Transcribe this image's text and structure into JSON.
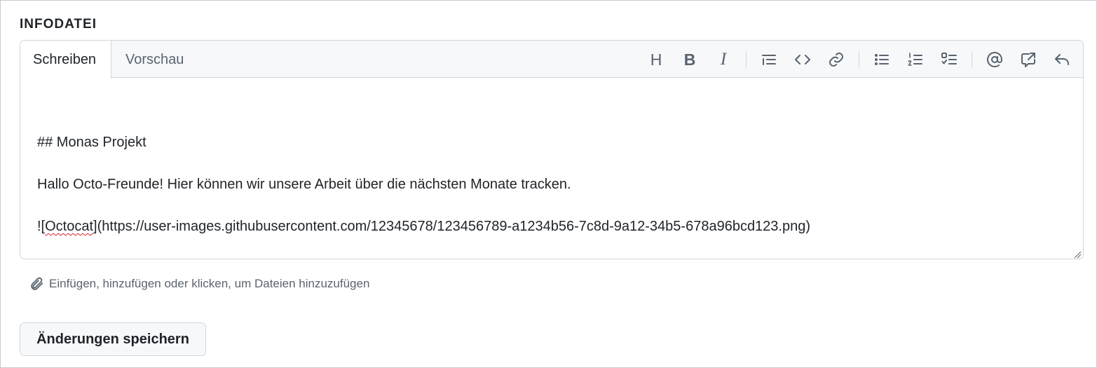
{
  "section_title": "INFODATEI",
  "tabs": {
    "write": "Schreiben",
    "preview": "Vorschau"
  },
  "toolbar": {
    "heading": "H",
    "bold": "B",
    "italic": "I",
    "icons": [
      "quote-icon",
      "code-icon",
      "link-icon",
      "unordered-list-icon",
      "ordered-list-icon",
      "task-list-icon",
      "mention-icon",
      "cross-reference-icon",
      "saved-reply-icon"
    ]
  },
  "content": {
    "line1": "## Monas Projekt",
    "line2": "Hallo Octo-Freunde! Hier können wir unsere Arbeit über die nächsten Monate tracken.",
    "line3_prefix": "![",
    "line3_misspelled": "Octocat",
    "line3_suffix": "](https://user-images.githubusercontent.com/12345678/123456789-a1234b56-7c8d-9a12-34b5-678a96bcd123.png)"
  },
  "attach_hint": "Einfügen, hinzufügen oder klicken, um Dateien hinzuzufügen",
  "save_button": "Änderungen speichern",
  "colors": {
    "header_bg": "#f6f8fa",
    "border": "#d0d7de",
    "muted_text": "#59636e",
    "spellcheck": "#cf222e"
  }
}
